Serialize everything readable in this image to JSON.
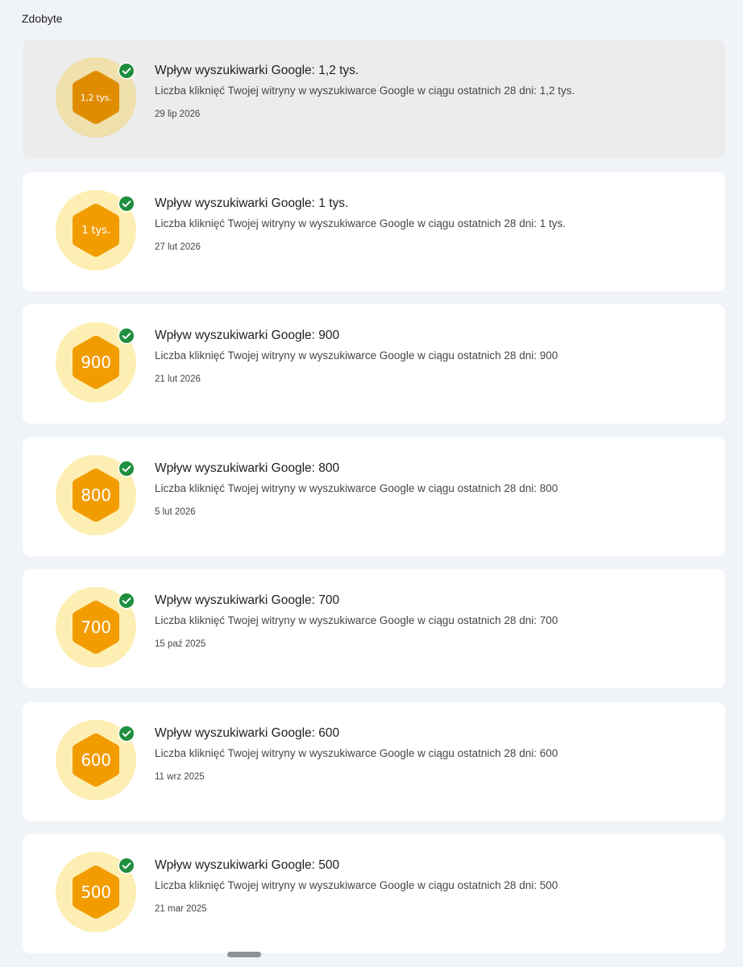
{
  "section": {
    "title": "Zdobyte"
  },
  "colors": {
    "hexagon_selected": "#e08c00",
    "hexagon": "#f29c00",
    "check": "#1e8e3e"
  },
  "icons": {
    "badge": "hexagon-icon",
    "earned": "check-circle-icon"
  },
  "achievements": [
    {
      "badge": "1,2 tys.",
      "title": "Wpływ wyszukiwarki Google: 1,2 tys.",
      "description": "Liczba kliknięć Twojej witryny w wyszukiwarce Google w ciągu ostatnich 28 dni: 1,2 tys.",
      "date": "29 lip 2026"
    },
    {
      "badge": "1 tys.",
      "title": "Wpływ wyszukiwarki Google: 1 tys.",
      "description": "Liczba kliknięć Twojej witryny w wyszukiwarce Google w ciągu ostatnich 28 dni: 1 tys.",
      "date": "27 lut 2026"
    },
    {
      "badge": "900",
      "title": "Wpływ wyszukiwarki Google: 900",
      "description": "Liczba kliknięć Twojej witryny w wyszukiwarce Google w ciągu ostatnich 28 dni: 900",
      "date": "21 lut 2026"
    },
    {
      "badge": "800",
      "title": "Wpływ wyszukiwarki Google: 800",
      "description": "Liczba kliknięć Twojej witryny w wyszukiwarce Google w ciągu ostatnich 28 dni: 800",
      "date": "5 lut 2026"
    },
    {
      "badge": "700",
      "title": "Wpływ wyszukiwarki Google: 700",
      "description": "Liczba kliknięć Twojej witryny w wyszukiwarce Google w ciągu ostatnich 28 dni: 700",
      "date": "15 paź 2025"
    },
    {
      "badge": "600",
      "title": "Wpływ wyszukiwarki Google: 600",
      "description": "Liczba kliknięć Twojej witryny w wyszukiwarce Google w ciągu ostatnich 28 dni: 600",
      "date": "11 wrz 2025"
    },
    {
      "badge": "500",
      "title": "Wpływ wyszukiwarki Google: 500",
      "description": "Liczba kliknięć Twojej witryny w wyszukiwarce Google w ciągu ostatnich 28 dni: 500",
      "date": "21 mar 2025"
    }
  ]
}
